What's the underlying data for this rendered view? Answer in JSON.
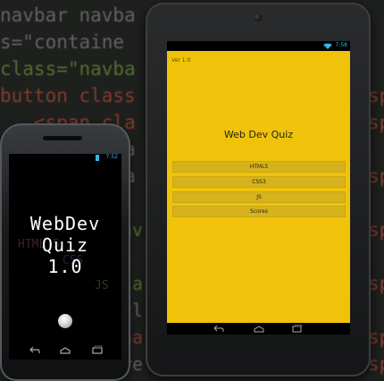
{
  "background_code": {
    "lines": [
      {
        "parts": [
          {
            "t": "navbar navba",
            "c": "c-grey"
          }
        ]
      },
      {
        "parts": [
          {
            "t": "s=\"containe",
            "c": "c-grey"
          }
        ]
      },
      {
        "parts": [
          {
            "t": "class=\"navba",
            "c": "c-grey"
          }
        ]
      },
      {
        "parts": [
          {
            "t": "button class",
            "c": "c-red"
          }
        ]
      },
      {
        "parts": [
          {
            "t": "   <span cla",
            "c": "c-red"
          }
        ]
      },
      {
        "parts": [
          {
            "t": "          la",
            "c": "c-grey"
          }
        ]
      },
      {
        "parts": [
          {
            "t": "          la",
            "c": "c-grey"
          }
        ]
      }
    ],
    "right_fragments": [
      "sp",
      "sp",
      "sp",
      "sp",
      "sp",
      "sp",
      "sp"
    ]
  },
  "phone": {
    "status_time": "7:52",
    "splash_faint": [
      "HTML 5",
      "CSS",
      "JS"
    ],
    "splash_title": [
      "WebDev",
      "Quiz",
      "1.0"
    ],
    "colors": {
      "status_accent": "#33b5e5",
      "splash_text": "#ffffff",
      "screen_bg": "#000000"
    }
  },
  "tablet": {
    "status_time": "7:58",
    "version_label": "Ver 1.0",
    "app_title": "Web Dev Quiz",
    "menu_buttons": [
      {
        "label": "HTML5"
      },
      {
        "label": "CSS3"
      },
      {
        "label": "JS"
      },
      {
        "label": "Scores"
      }
    ],
    "colors": {
      "screen_bg": "#f0c30a",
      "button_bg": "#d6b21d",
      "status_accent": "#33b5e5"
    }
  },
  "icons": [
    "wifi-icon",
    "battery-icon",
    "back-icon",
    "home-icon",
    "recents-icon",
    "camera-icon",
    "home-button-icon"
  ]
}
